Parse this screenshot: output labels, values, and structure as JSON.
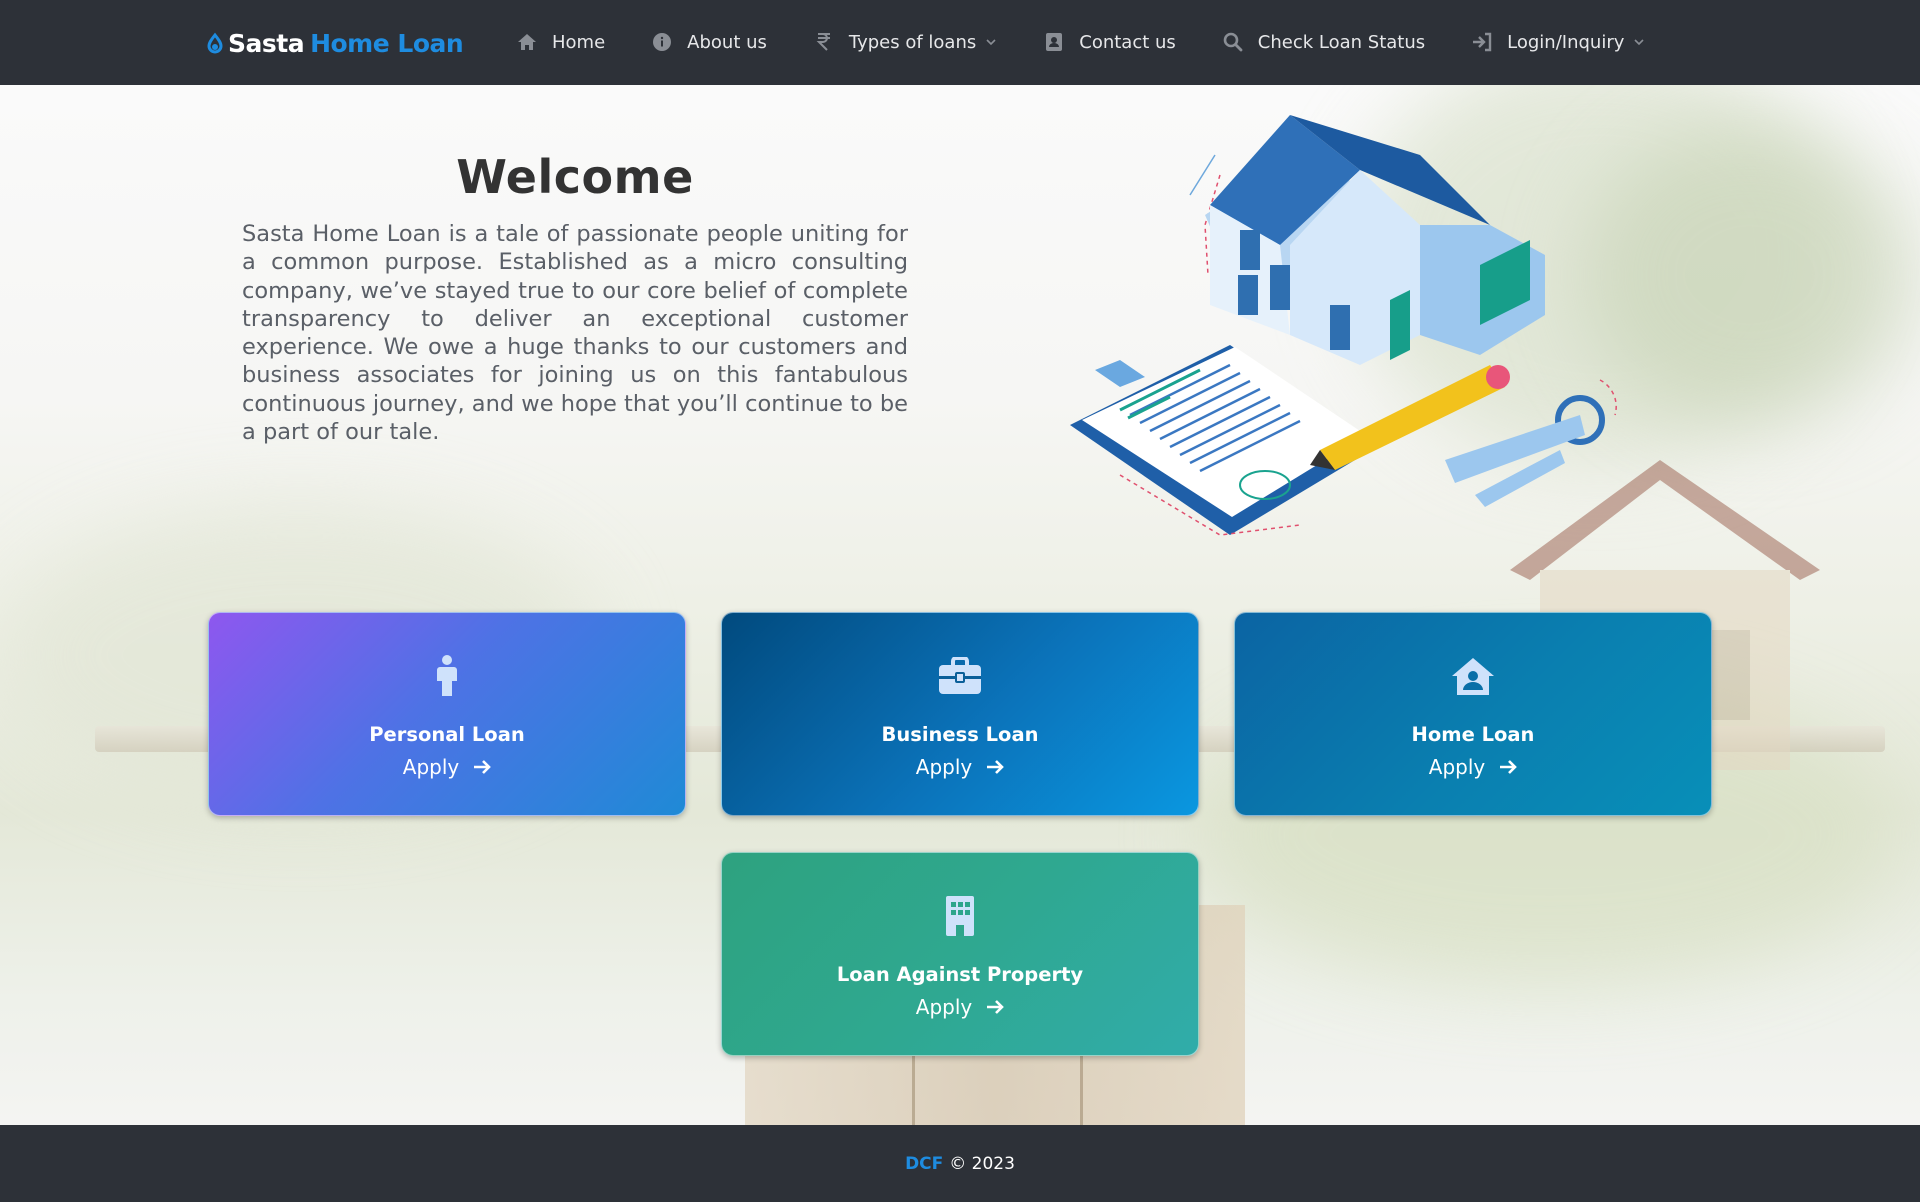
{
  "brand": {
    "part1": "Sasta",
    "part2": "Home Loan"
  },
  "nav": {
    "items": [
      {
        "label": "Home",
        "icon": "home-icon"
      },
      {
        "label": "About us",
        "icon": "info-icon"
      },
      {
        "label": "Types of loans",
        "icon": "rupee-icon",
        "dropdown": true
      },
      {
        "label": "Contact us",
        "icon": "contact-card-icon"
      },
      {
        "label": "Check Loan Status",
        "icon": "search-icon"
      },
      {
        "label": "Login/Inquiry",
        "icon": "sign-in-icon",
        "dropdown": true
      }
    ]
  },
  "welcome": {
    "title": "Welcome",
    "text": "Sasta Home Loan is a tale of passionate people uniting for a common purpose. Established as a micro consulting company, we’ve stayed true to our core belief of complete transparency to deliver an exceptional customer experience. We owe a huge thanks to our customers and business associates for joining us on this fantabulous continuous journey, and we hope that you’ll continue to be a part of our tale."
  },
  "cards": [
    {
      "title": "Personal Loan",
      "apply": "Apply",
      "icon": "person-icon"
    },
    {
      "title": "Business Loan",
      "apply": "Apply",
      "icon": "briefcase-icon"
    },
    {
      "title": "Home Loan",
      "apply": "Apply",
      "icon": "house-user-icon"
    },
    {
      "title": "Loan Against Property",
      "apply": "Apply",
      "icon": "building-icon"
    }
  ],
  "footer": {
    "brand": "DCF",
    "text": "© 2023"
  },
  "colors": {
    "nav_bg": "#2d3138",
    "brand_blue": "#1e8ce0"
  }
}
